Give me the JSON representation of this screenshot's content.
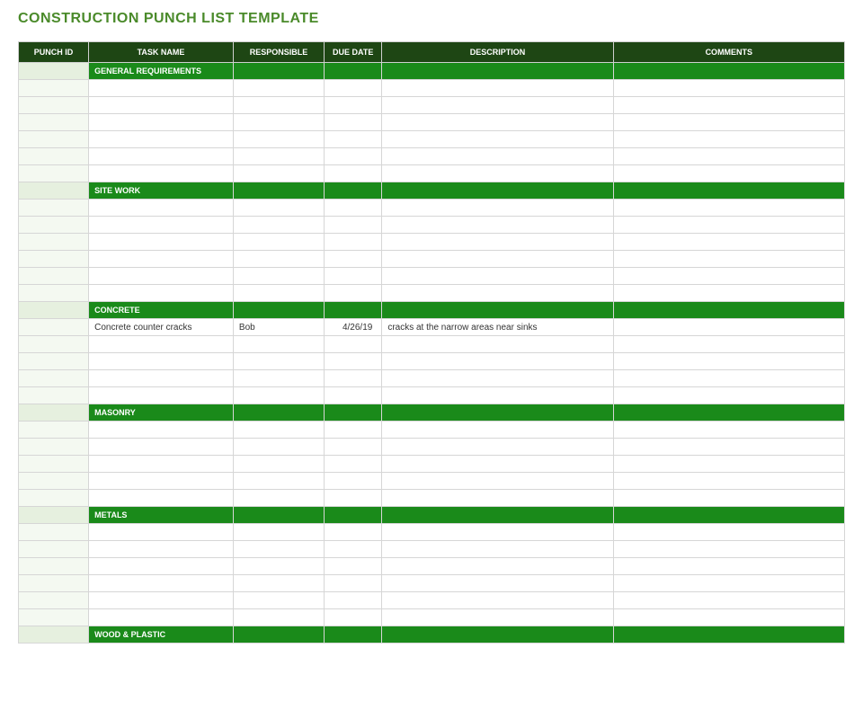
{
  "title": "CONSTRUCTION PUNCH LIST TEMPLATE",
  "columns": {
    "punch_id": "PUNCH ID",
    "task_name": "TASK NAME",
    "responsible": "RESPONSIBLE",
    "due_date": "DUE DATE",
    "description": "DESCRIPTION",
    "comments": "COMMENTS"
  },
  "sections": [
    {
      "name": "GENERAL REQUIREMENTS",
      "rows": [
        {
          "punch_id": "",
          "task": "",
          "resp": "",
          "due": "",
          "desc": "",
          "com": ""
        },
        {
          "punch_id": "",
          "task": "",
          "resp": "",
          "due": "",
          "desc": "",
          "com": ""
        },
        {
          "punch_id": "",
          "task": "",
          "resp": "",
          "due": "",
          "desc": "",
          "com": ""
        },
        {
          "punch_id": "",
          "task": "",
          "resp": "",
          "due": "",
          "desc": "",
          "com": ""
        },
        {
          "punch_id": "",
          "task": "",
          "resp": "",
          "due": "",
          "desc": "",
          "com": ""
        },
        {
          "punch_id": "",
          "task": "",
          "resp": "",
          "due": "",
          "desc": "",
          "com": ""
        }
      ]
    },
    {
      "name": "SITE WORK",
      "rows": [
        {
          "punch_id": "",
          "task": "",
          "resp": "",
          "due": "",
          "desc": "",
          "com": ""
        },
        {
          "punch_id": "",
          "task": "",
          "resp": "",
          "due": "",
          "desc": "",
          "com": ""
        },
        {
          "punch_id": "",
          "task": "",
          "resp": "",
          "due": "",
          "desc": "",
          "com": ""
        },
        {
          "punch_id": "",
          "task": "",
          "resp": "",
          "due": "",
          "desc": "",
          "com": ""
        },
        {
          "punch_id": "",
          "task": "",
          "resp": "",
          "due": "",
          "desc": "",
          "com": ""
        },
        {
          "punch_id": "",
          "task": "",
          "resp": "",
          "due": "",
          "desc": "",
          "com": ""
        }
      ]
    },
    {
      "name": "CONCRETE",
      "rows": [
        {
          "punch_id": "",
          "task": "Concrete counter cracks",
          "resp": "Bob",
          "due": "4/26/19",
          "desc": "cracks at the narrow areas near sinks",
          "com": ""
        },
        {
          "punch_id": "",
          "task": "",
          "resp": "",
          "due": "",
          "desc": "",
          "com": ""
        },
        {
          "punch_id": "",
          "task": "",
          "resp": "",
          "due": "",
          "desc": "",
          "com": ""
        },
        {
          "punch_id": "",
          "task": "",
          "resp": "",
          "due": "",
          "desc": "",
          "com": ""
        },
        {
          "punch_id": "",
          "task": "",
          "resp": "",
          "due": "",
          "desc": "",
          "com": ""
        }
      ]
    },
    {
      "name": "MASONRY",
      "rows": [
        {
          "punch_id": "",
          "task": "",
          "resp": "",
          "due": "",
          "desc": "",
          "com": ""
        },
        {
          "punch_id": "",
          "task": "",
          "resp": "",
          "due": "",
          "desc": "",
          "com": ""
        },
        {
          "punch_id": "",
          "task": "",
          "resp": "",
          "due": "",
          "desc": "",
          "com": ""
        },
        {
          "punch_id": "",
          "task": "",
          "resp": "",
          "due": "",
          "desc": "",
          "com": ""
        },
        {
          "punch_id": "",
          "task": "",
          "resp": "",
          "due": "",
          "desc": "",
          "com": ""
        }
      ]
    },
    {
      "name": "METALS",
      "rows": [
        {
          "punch_id": "",
          "task": "",
          "resp": "",
          "due": "",
          "desc": "",
          "com": ""
        },
        {
          "punch_id": "",
          "task": "",
          "resp": "",
          "due": "",
          "desc": "",
          "com": ""
        },
        {
          "punch_id": "",
          "task": "",
          "resp": "",
          "due": "",
          "desc": "",
          "com": ""
        },
        {
          "punch_id": "",
          "task": "",
          "resp": "",
          "due": "",
          "desc": "",
          "com": ""
        },
        {
          "punch_id": "",
          "task": "",
          "resp": "",
          "due": "",
          "desc": "",
          "com": ""
        },
        {
          "punch_id": "",
          "task": "",
          "resp": "",
          "due": "",
          "desc": "",
          "com": ""
        }
      ]
    },
    {
      "name": "WOOD & PLASTIC",
      "rows": []
    }
  ]
}
